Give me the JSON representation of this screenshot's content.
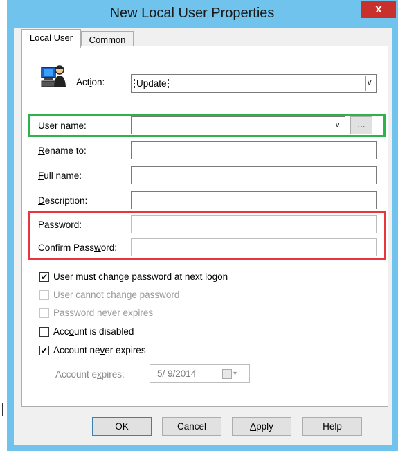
{
  "window": {
    "title": "New Local User Properties",
    "close_glyph": "x"
  },
  "tabs": [
    {
      "label": "Local User"
    },
    {
      "label": "Common"
    }
  ],
  "action": {
    "icon": "users-computer-icon",
    "label_pre": "Act",
    "label_key": "i",
    "label_post": "on:",
    "value": "Update"
  },
  "fields": {
    "user_name": {
      "label_key": "U",
      "label_rest": "ser name:",
      "value": ""
    },
    "browse_button": "...",
    "rename_to": {
      "label_key": "R",
      "label_rest": "ename to:",
      "value": ""
    },
    "full_name": {
      "label_key": "F",
      "label_rest": "ull name:",
      "value": ""
    },
    "description": {
      "label_key": "D",
      "label_rest": "escription:",
      "value": ""
    },
    "password": {
      "label_key": "P",
      "label_rest": "assword:",
      "value": ""
    },
    "confirm_password": {
      "label_pre": "Confirm Pass",
      "label_key": "w",
      "label_post": "ord:",
      "value": ""
    }
  },
  "checkboxes": [
    {
      "pre": "User ",
      "key": "m",
      "post": "ust change password at next logon",
      "checked": true,
      "enabled": true
    },
    {
      "pre": "User ",
      "key": "c",
      "post": "annot change password",
      "checked": false,
      "enabled": false
    },
    {
      "pre": "Password ",
      "key": "n",
      "post": "ever expires",
      "checked": false,
      "enabled": false
    },
    {
      "pre": "Acc",
      "key": "o",
      "post": "unt is disabled",
      "checked": false,
      "enabled": true
    },
    {
      "pre": "Account ne",
      "key": "v",
      "post": "er expires",
      "checked": true,
      "enabled": true
    }
  ],
  "account_expires": {
    "label_pre": "Account e",
    "label_key": "x",
    "label_post": "pires:",
    "date": "5/ 9/2014"
  },
  "buttons": {
    "ok": "OK",
    "cancel": "Cancel",
    "apply": "Apply",
    "help": "Help"
  },
  "colors": {
    "title_bar": "#6fc3ec",
    "close": "#c9302c",
    "highlight_green": "#2db34a",
    "highlight_red": "#e8363c"
  }
}
